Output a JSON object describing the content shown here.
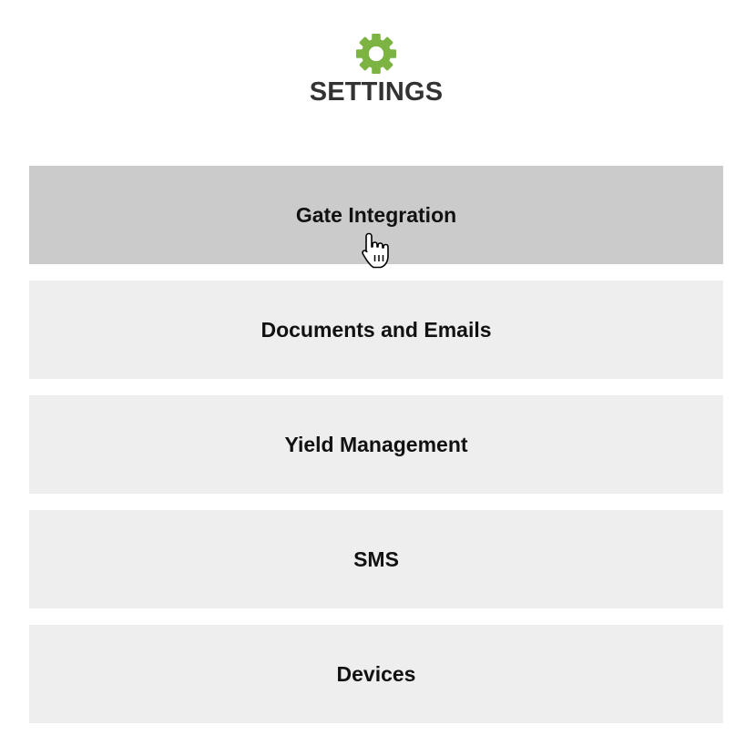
{
  "header": {
    "icon": "gear-icon",
    "title": "SETTINGS",
    "icon_color": "#7cb342"
  },
  "menu": {
    "items": [
      {
        "label": "Gate Integration",
        "state": "hover"
      },
      {
        "label": "Documents and Emails",
        "state": "normal"
      },
      {
        "label": "Yield Management",
        "state": "normal"
      },
      {
        "label": "SMS",
        "state": "normal"
      },
      {
        "label": "Devices",
        "state": "normal"
      }
    ]
  },
  "colors": {
    "item_bg": "#eeeeee",
    "item_hover_bg": "#cbcbcb",
    "title_text": "#333333",
    "item_text": "#111111"
  },
  "cursor": "hand-pointer-icon"
}
